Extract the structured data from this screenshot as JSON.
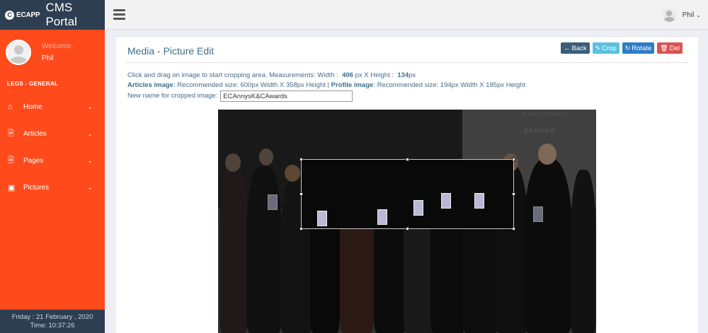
{
  "brand": {
    "logo_text": "ECAPP",
    "logo_letter": "C",
    "app_name": "CMS Portal"
  },
  "user_panel": {
    "welcome": "Welcome,",
    "name": "Phil"
  },
  "sidebar": {
    "section_label": "LEGS - GENERAL",
    "items": [
      {
        "label": "Home",
        "icon": "home-icon"
      },
      {
        "label": "Articles",
        "icon": "file-icon"
      },
      {
        "label": "Pages",
        "icon": "file-icon"
      },
      {
        "label": "Pictures",
        "icon": "image-icon"
      }
    ]
  },
  "clock": {
    "date": "Friday : 21 February , 2020",
    "time": "Time: 10:37:26"
  },
  "topbar": {
    "user_name": "Phil"
  },
  "page": {
    "title": "Media - Picture Edit",
    "buttons": {
      "back": "Back",
      "crop": "Crop",
      "rotate": "Rotate",
      "del": "Del"
    },
    "measure_prefix": "Click and drag on image to start cropping area. Measurements: Width :",
    "width_value": "406",
    "width_unit": "px X  Height :",
    "height_value": "134",
    "height_unit": "px",
    "articles_label": "Articles image",
    "articles_text": ": Recommended size: 600px Width X 358px Height |",
    "profile_label": "Profile image",
    "profile_text": ": Recommended size: 194px Width X 185px Height",
    "newname_label": "New name for cropped image:",
    "newname_value": "ECAnnysK&CAwards"
  },
  "photo": {
    "banner_small": "IN ASSOCIATION WITH",
    "banner_big": "BANHAM"
  },
  "colors": {
    "sidebar": "#ff4a1c",
    "brand_bar": "#2d3e50",
    "title": "#3c6f8c"
  }
}
